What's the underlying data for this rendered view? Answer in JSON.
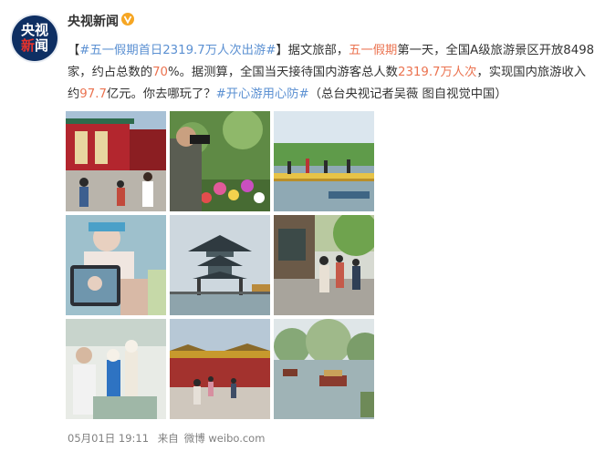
{
  "account": {
    "avatar_line1": "央视",
    "avatar_line2a": "新",
    "avatar_line2b": "闻",
    "name": "央视新闻"
  },
  "post": {
    "open_bracket": "【",
    "topic": "#五一假期首日2319.7万人次出游#",
    "close_bracket": "】",
    "t1": "据文旅部，",
    "kw1": "五一假期",
    "t2": "第一天，全国A级旅游景区开放8498家，约占总数的",
    "kw2": "70",
    "t3": "%。据测算，全国当天接待国内游客总人数",
    "kw3": "2319.7万人次",
    "t4": "，实现国内旅游收入约",
    "kw4": "97.7",
    "t5": "亿元。你去哪玩了？",
    "hashtag": "#开心游用心防#",
    "t6": "（总台央视记者吴薇 图自视觉中国）"
  },
  "footer": {
    "timestamp": "05月01日 19:11",
    "source_prefix": "来自",
    "source": "微博 weibo.com"
  },
  "colors": {
    "keyword": "#eb7350",
    "link": "#5b90d2",
    "verified": "#f6a623"
  }
}
